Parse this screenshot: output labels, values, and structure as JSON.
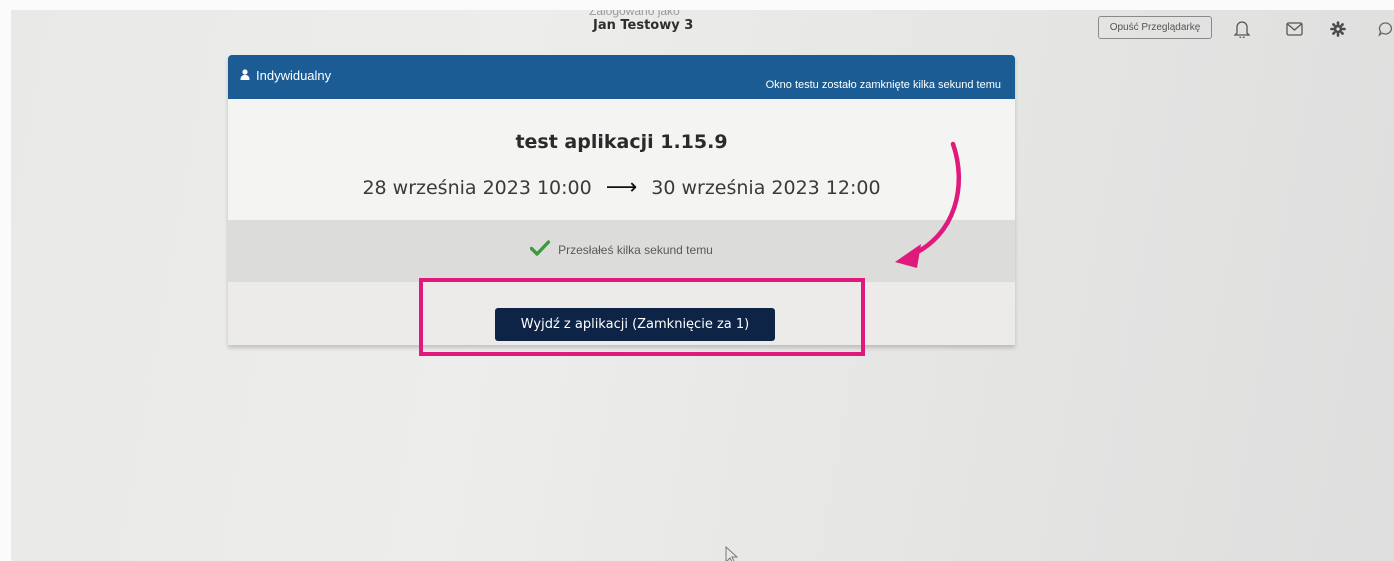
{
  "header": {
    "logged_in_label": "Zalogowano jako",
    "user_name": "Jan Testowy 3",
    "leave_browser_label": "Opuść Przeglądarkę",
    "icons": [
      "bell-icon",
      "envelope-icon",
      "gear-icon",
      "chat-icon"
    ]
  },
  "card": {
    "mode_icon": "user-icon",
    "mode_label": "Indywidualny",
    "window_status": "Okno testu zostało zamknięte kilka sekund temu",
    "test_title": "test aplikacji 1.15.9",
    "start_date": "28 września 2023 10:00",
    "date_arrow": "⟶",
    "end_date": "30 września 2023 12:00",
    "status_icon": "check-icon",
    "status_text": "Przesłałeś kilka sekund temu",
    "exit_button_label": "Wyjdź z aplikacji (Zamknięcie za 1)"
  },
  "colors": {
    "header_blue": "#1b5c94",
    "button_navy": "#0e2447",
    "check_green": "#3f9a3f",
    "annotation_pink": "#e0197d"
  }
}
